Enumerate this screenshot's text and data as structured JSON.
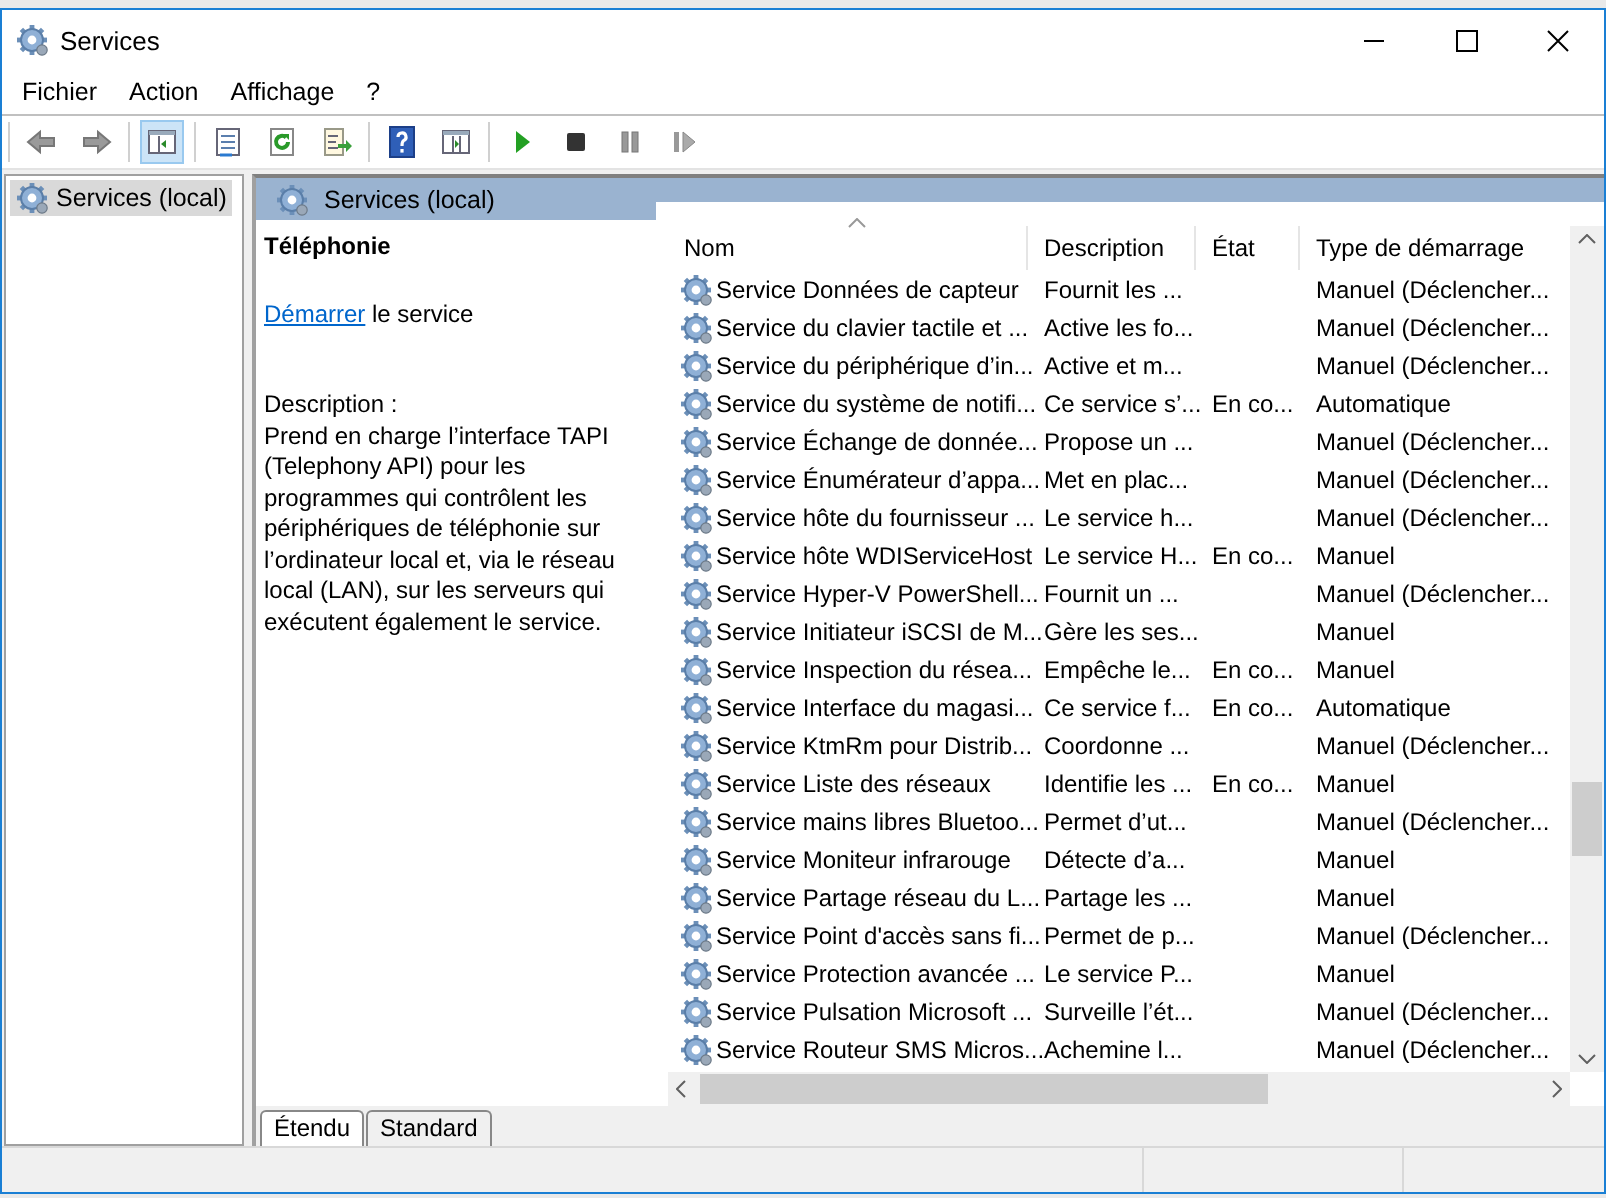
{
  "window": {
    "title": "Services"
  },
  "menu": [
    "Fichier",
    "Action",
    "Affichage",
    "?"
  ],
  "toolbar": {
    "groups": [
      [
        {
          "kind": "back",
          "pressed": false
        },
        {
          "kind": "forward",
          "pressed": false
        }
      ],
      [
        {
          "kind": "tree",
          "pressed": true
        }
      ],
      [
        {
          "kind": "properties",
          "pressed": false
        },
        {
          "kind": "refresh",
          "pressed": false
        },
        {
          "kind": "export",
          "pressed": false
        }
      ],
      [
        {
          "kind": "help",
          "pressed": false
        },
        {
          "kind": "console",
          "pressed": false
        }
      ],
      [
        {
          "kind": "play",
          "pressed": false
        },
        {
          "kind": "stop",
          "pressed": false
        },
        {
          "kind": "pause",
          "pressed": false
        },
        {
          "kind": "resume",
          "pressed": false
        }
      ]
    ]
  },
  "tree": {
    "items": [
      {
        "label": "Services (local)",
        "selected": true
      }
    ]
  },
  "panel": {
    "title": "Services (local)"
  },
  "details": {
    "service_name": "Téléphonie",
    "action_link": "Démarrer",
    "action_text": "le service",
    "description_label": "Description :",
    "description": "Prend en charge l’interface TAPI (Telephony API) pour les programmes qui contrôlent les périphériques de téléphonie sur l’ordinateur local et, via le réseau local (LAN), sur les serveurs qui exécutent également le service."
  },
  "table": {
    "columns": [
      {
        "label": "Nom",
        "sorted": true
      },
      {
        "label": "Description",
        "sorted": false
      },
      {
        "label": "État",
        "sorted": false
      },
      {
        "label": "Type de démarrage",
        "sorted": false
      }
    ],
    "rows": [
      {
        "name": "Service Données de capteur",
        "description": "Fournit les ...",
        "startup": "Manuel (Déclencher..."
      },
      {
        "name": "Service du clavier tactile et ...",
        "description": "Active les fo...",
        "startup": "Manuel (Déclencher..."
      },
      {
        "name": "Service du périphérique d’in...",
        "description": "Active et m...",
        "startup": "Manuel (Déclencher..."
      },
      {
        "name": "Service du système de notifi...",
        "description": "Ce service s’...",
        "state": "En co...",
        "startup": "Automatique"
      },
      {
        "name": "Service Échange de donnée...",
        "description": "Propose un ...",
        "startup": "Manuel (Déclencher..."
      },
      {
        "name": "Service Énumérateur d’appa...",
        "description": "Met en plac...",
        "startup": "Manuel (Déclencher..."
      },
      {
        "name": "Service hôte du fournisseur ...",
        "description": "Le service h...",
        "startup": "Manuel (Déclencher..."
      },
      {
        "name": "Service hôte WDIServiceHost",
        "description": "Le service H...",
        "state": "En co...",
        "startup": "Manuel"
      },
      {
        "name": "Service Hyper-V PowerShell...",
        "description": "Fournit un ...",
        "startup": "Manuel (Déclencher..."
      },
      {
        "name": "Service Initiateur iSCSI de M...",
        "description": "Gère les ses...",
        "startup": "Manuel"
      },
      {
        "name": "Service Inspection du résea...",
        "description": "Empêche le...",
        "state": "En co...",
        "startup": "Manuel"
      },
      {
        "name": "Service Interface du magasi...",
        "description": "Ce service f...",
        "state": "En co...",
        "startup": "Automatique"
      },
      {
        "name": "Service KtmRm pour Distrib...",
        "description": "Coordonne ...",
        "startup": "Manuel (Déclencher..."
      },
      {
        "name": "Service Liste des réseaux",
        "description": "Identifie les ...",
        "state": "En co...",
        "startup": "Manuel"
      },
      {
        "name": "Service mains libres Bluetoo...",
        "description": "Permet d’ut...",
        "startup": "Manuel (Déclencher..."
      },
      {
        "name": "Service Moniteur infrarouge",
        "description": "Détecte d’a...",
        "startup": "Manuel"
      },
      {
        "name": "Service Partage réseau du L...",
        "description": "Partage les ...",
        "startup": "Manuel"
      },
      {
        "name": "Service Point d'accès sans fi...",
        "description": "Permet de p...",
        "startup": "Manuel (Déclencher..."
      },
      {
        "name": "Service Protection avancée ...",
        "description": "Le service P...",
        "startup": "Manuel"
      },
      {
        "name": "Service Pulsation Microsoft ...",
        "description": "Surveille l’ét...",
        "startup": "Manuel (Déclencher..."
      },
      {
        "name": "Service Routeur SMS Micros...",
        "description": "Achemine l...",
        "startup": "Manuel (Déclencher..."
      }
    ]
  },
  "view_tabs": [
    {
      "label": "Étendu",
      "selected": true
    },
    {
      "label": "Standard",
      "selected": false
    }
  ]
}
